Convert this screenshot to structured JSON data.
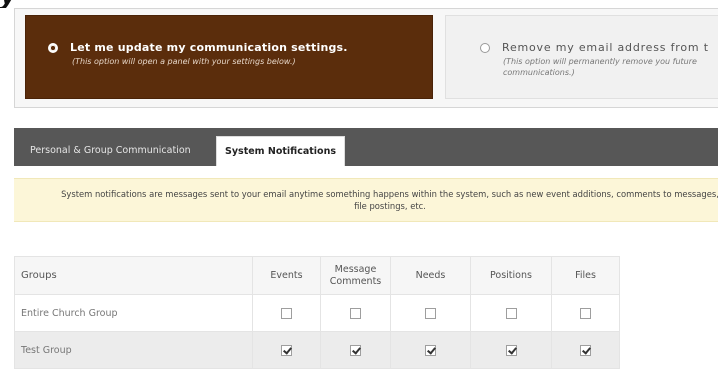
{
  "options": {
    "update": {
      "title": "Let me update my communication settings.",
      "subtitle": "(This option will open a panel with your settings below.)",
      "selected": true
    },
    "remove": {
      "title": "Remove my email address from t",
      "subtitle": "(This option will permanently remove you future communications.)",
      "selected": false
    }
  },
  "tabs": [
    {
      "label": "Personal & Group Communication",
      "active": false
    },
    {
      "label": "System Notifications",
      "active": true
    }
  ],
  "info_text": "System notifications are messages sent to your email anytime something happens within the system, such as new event additions, comments to messages, file postings, etc.",
  "table": {
    "group_header": "Groups",
    "columns": [
      "Events",
      "Message Comments",
      "Needs",
      "Positions",
      "Files"
    ],
    "rows": [
      {
        "name": "Entire Church Group",
        "checks": [
          false,
          false,
          false,
          false,
          false
        ]
      },
      {
        "name": "Test Group",
        "checks": [
          true,
          true,
          true,
          true,
          true
        ]
      }
    ]
  },
  "colors": {
    "selected_option_bg": "#5b2d0c",
    "tabbar_bg": "#575757",
    "banner_bg": "#fcf6d8"
  }
}
